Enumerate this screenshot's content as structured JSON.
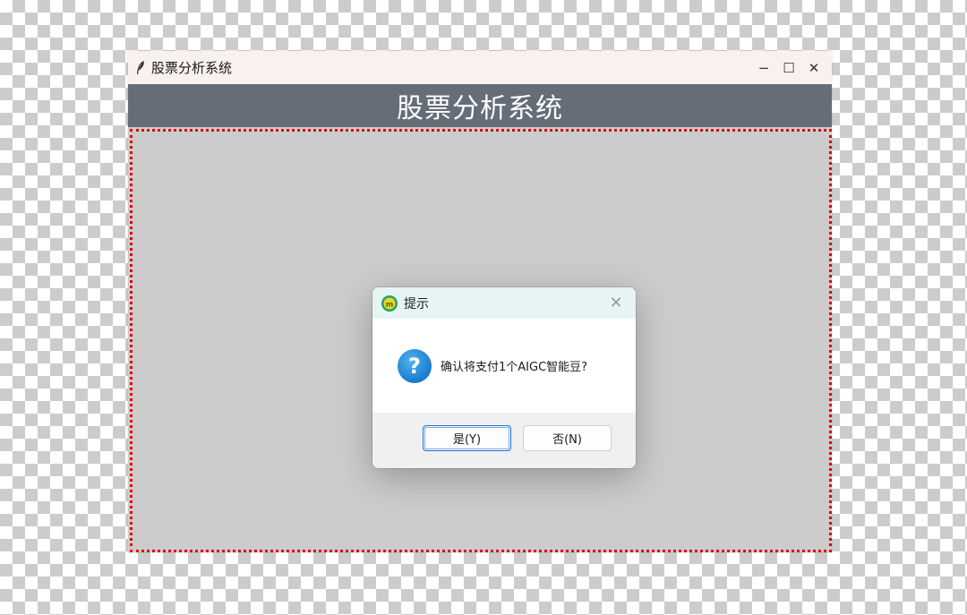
{
  "window": {
    "title": "股票分析系统",
    "controls": {
      "minimize": "−",
      "maximize": "☐",
      "close": "✕"
    }
  },
  "header": {
    "heading": "股票分析系统"
  },
  "colors": {
    "header_band": "#646d78",
    "content_bg": "#cccccc",
    "content_border": "#e00000",
    "dialog_titlebar": "#e6f5f4",
    "question_icon": "#1b8ad6"
  },
  "dialog": {
    "title": "提示",
    "close": "✕",
    "icon": "question-icon",
    "message": "确认将支付1个AIGC智能豆?",
    "buttons": {
      "yes": "是(Y)",
      "no": "否(N)"
    }
  }
}
